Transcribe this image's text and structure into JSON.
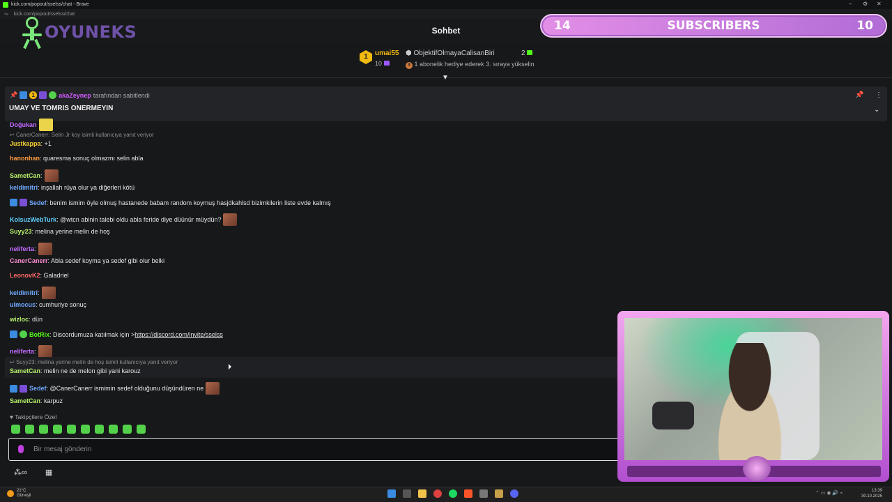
{
  "browser": {
    "title": "kick.com/popout/sselss/chat - Brave",
    "url": "kick.com/popout/sselss/chat"
  },
  "logo": {
    "text": "OYUNEKS"
  },
  "header": {
    "title": "Sohbet"
  },
  "subs_overlay": {
    "left": "14",
    "label": "SUBSCRIBERS",
    "right": "10"
  },
  "leaderboard": {
    "rank1": "1",
    "user1": "umai55",
    "count1": "10",
    "user2": "ObjektifOlmayaCalisanBiri",
    "count2": "2",
    "promo_rank": "3",
    "promo": "1 abonelik hediye ederek 3. sıraya yükselin"
  },
  "pinned": {
    "rank": "1",
    "pinner": "akaZeynep",
    "pinned_by": "tarafından sabitlendi",
    "message": "UMAY VE TOMRIS ONERMEYIN"
  },
  "chat": {
    "top_partial_user": "Doğukan",
    "reply1": "CanerCanerr: Selin Jr koy isimli kullanıcıya yanıt veriyor",
    "messages": [
      {
        "user": "Justkappa",
        "text": ": +1",
        "color": "#f5d033"
      },
      {
        "user": "hanonhan",
        "text": ": quaresma sonuç olmazmı selin abla",
        "color": "#ff9b3d"
      },
      {
        "user": "SametCan",
        "text": ":",
        "color": "#b8f36a"
      },
      {
        "user": "keldimitri",
        "text": ": inşallah rüya olur ya diğerleri kötü",
        "color": "#6fa9ff"
      },
      {
        "user": "Sedef",
        "text": ": benim ismim öyle olmuş hastanede babam random koymuş hasjdkahlsd bizimkilerin liste evde kalmış",
        "color": "#6fa9ff"
      },
      {
        "user": "KolsuzWebTurk",
        "text": ": @wtcn abinin talebi oldu abla feride diye düünür müydün?",
        "color": "#5fd0ff"
      },
      {
        "user": "Suyy23",
        "text": ": melina yerine melin de hoş",
        "color": "#b8f36a"
      },
      {
        "user": "neliferta",
        "text": ":",
        "color": "#c26bff"
      },
      {
        "user": "CanerCanerr",
        "text": ": Abla sedef koyma ya sedef gibi olur belki",
        "color": "#ff8fd6"
      },
      {
        "user": "LeonovK2",
        "text": ": Galadriel",
        "color": "#ff6a6a"
      },
      {
        "user": "keldimitri",
        "text": ":",
        "color": "#6fa9ff"
      },
      {
        "user": "ulmocus",
        "text": ": cumhuriye sonuç",
        "color": "#6fa9ff"
      },
      {
        "user": "wizloc",
        "text": ": dün",
        "color": "#b8f36a"
      },
      {
        "user": "BotRix",
        "text": ": Discordumuza katılmak için > ",
        "link": "https://discord.com/invite/sselss",
        "color": "#53fc18"
      },
      {
        "user": "neliferta",
        "text": ":",
        "color": "#c26bff"
      }
    ],
    "reply2": "Suyy23: melina yerine melin de hoş isimli kullanıcıya yanıt veriyor",
    "messages2": [
      {
        "user": "SametCan",
        "text": ": melin ne de melon gibi yani karouz",
        "color": "#b8f36a"
      },
      {
        "user": "Sedef",
        "text": ": @CanerCanerr ismimin sedef olduğunu düşündüren ne",
        "color": "#6fa9ff"
      },
      {
        "user": "SametCan",
        "text": ": karpuz",
        "color": "#b8f36a"
      }
    ]
  },
  "followers_only": "Takipçilere Özel",
  "input": {
    "placeholder": "Bir mesaj gönderin"
  },
  "taskbar": {
    "temp": "21°C",
    "weather": "Güneşli",
    "time": "13:39",
    "date": "30.10.2025"
  },
  "colors": {
    "kick_green": "#53fc18",
    "accent_purple": "#b26cd6"
  }
}
